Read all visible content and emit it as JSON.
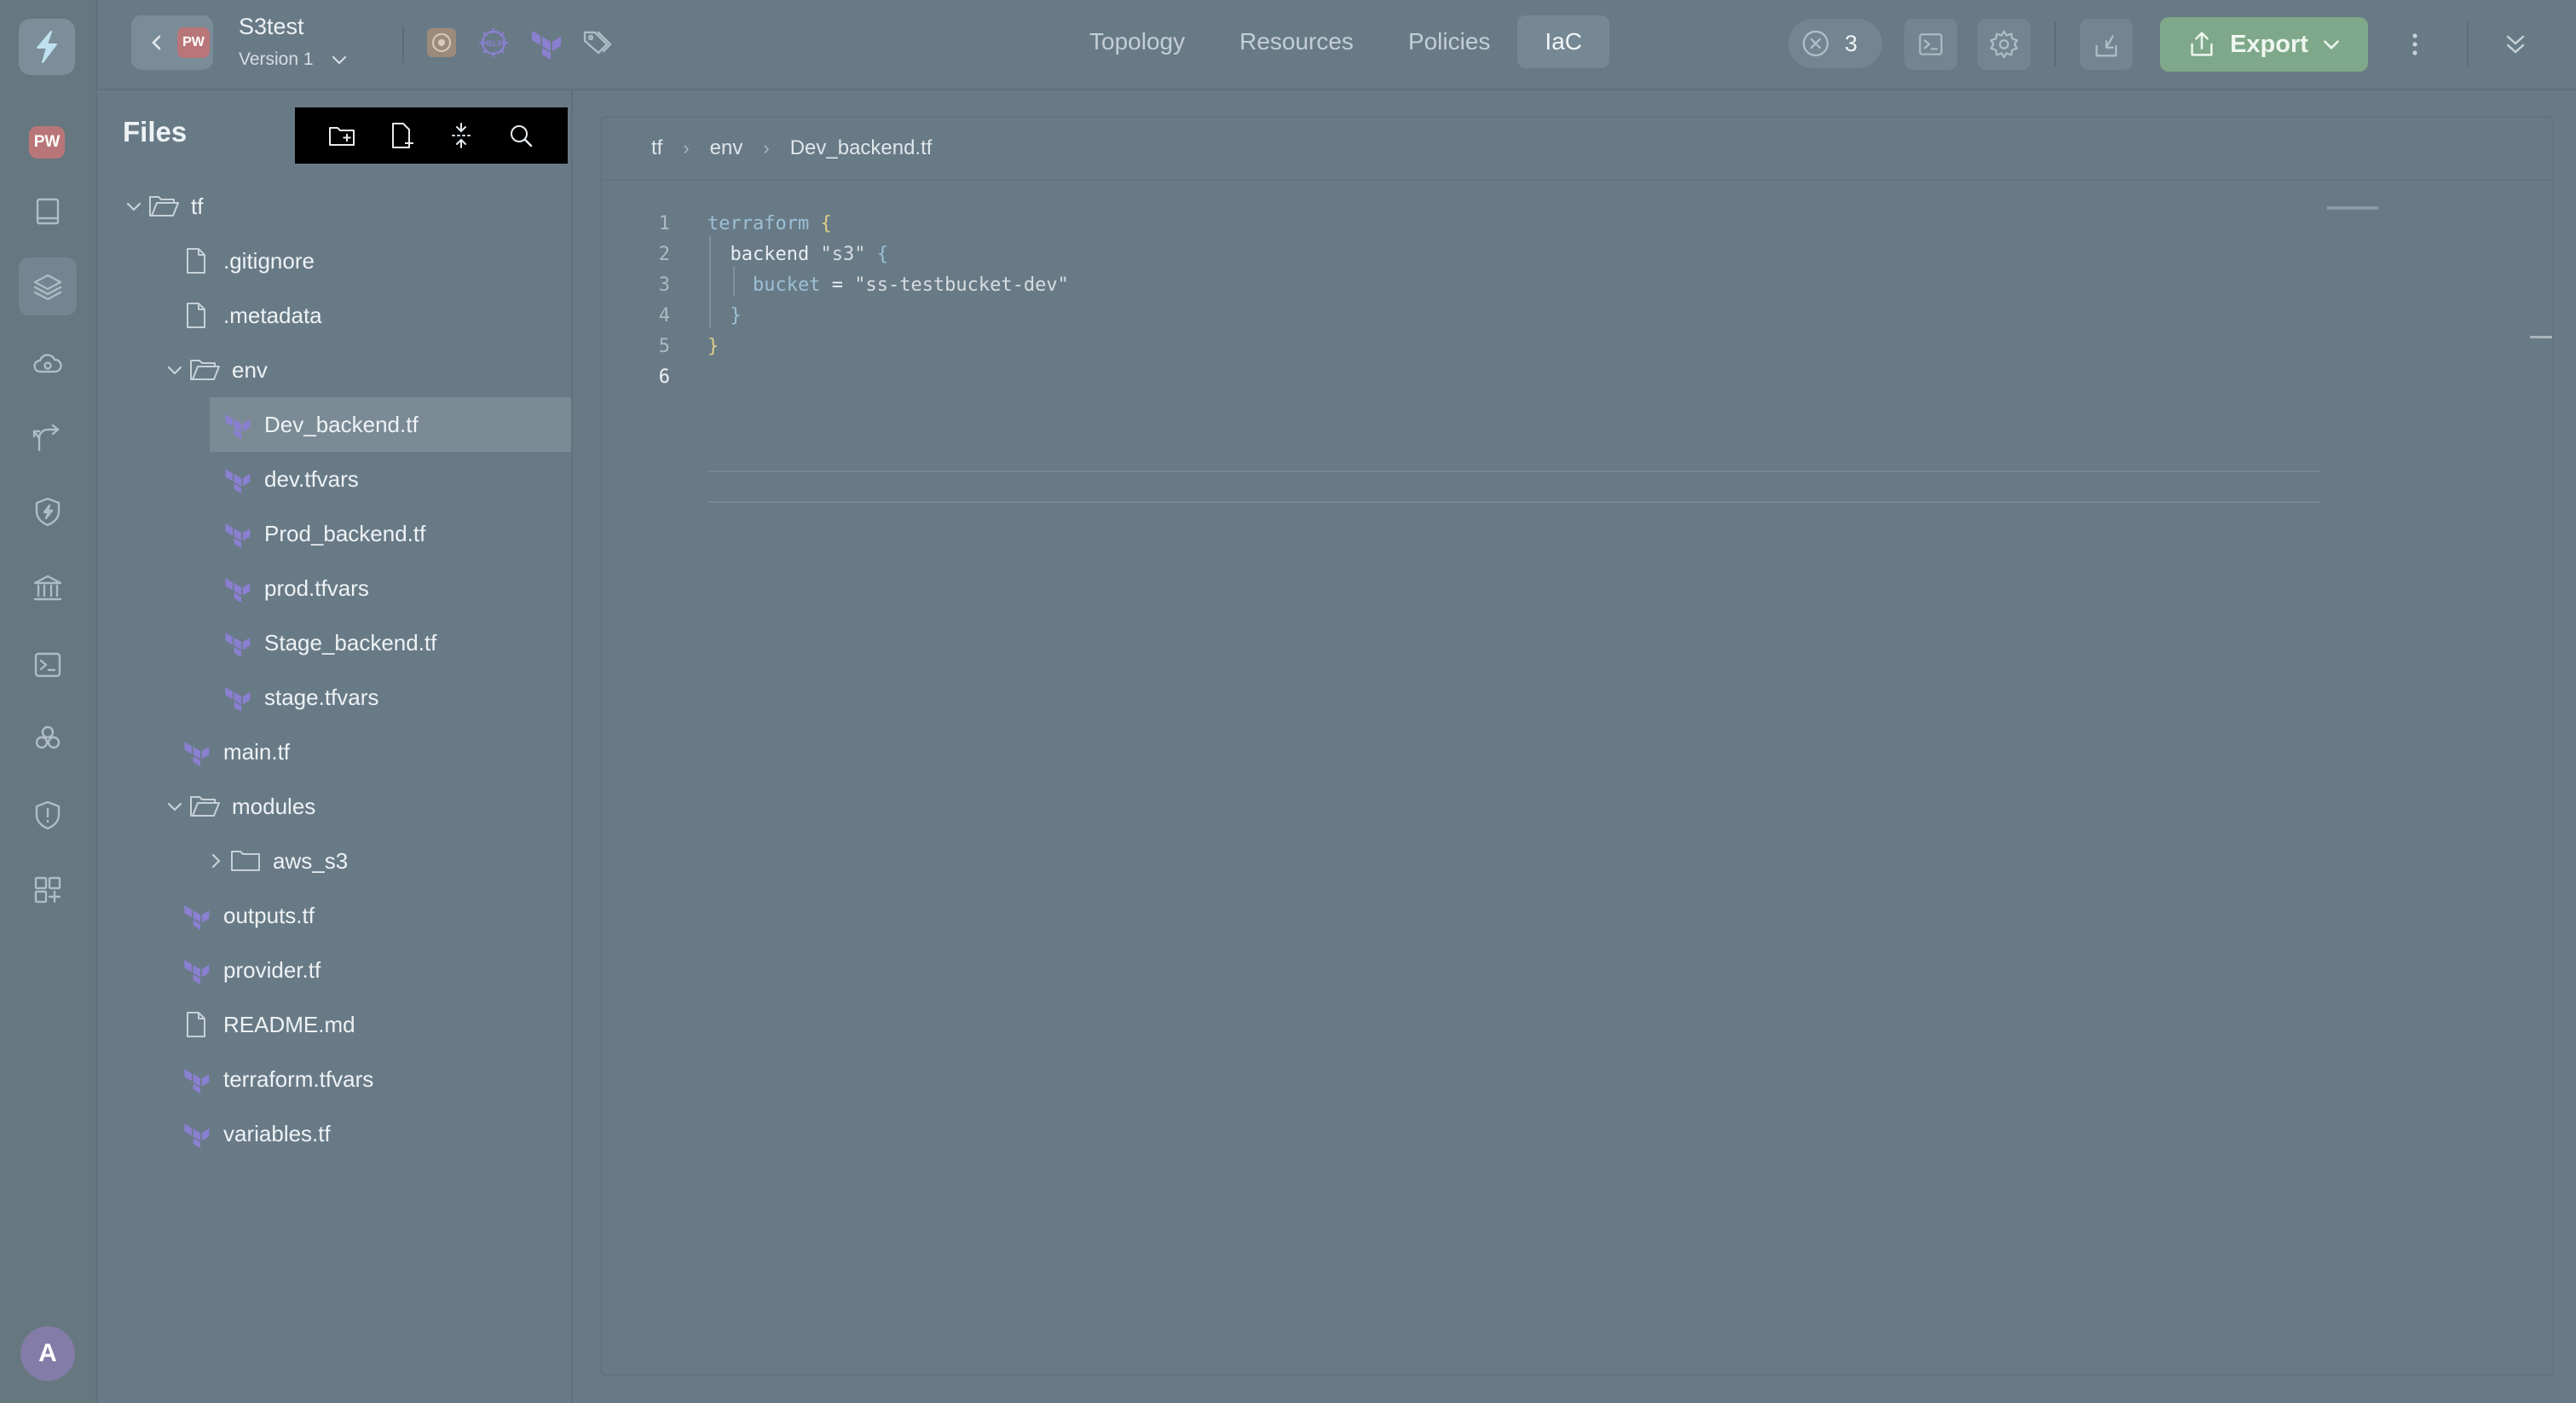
{
  "project": {
    "name": "S3test",
    "version": "Version 1",
    "badge": "PW"
  },
  "rail": {
    "badge": "PW",
    "avatar": "A"
  },
  "tabs": [
    {
      "label": "Topology",
      "active": false
    },
    {
      "label": "Resources",
      "active": false
    },
    {
      "label": "Policies",
      "active": false
    },
    {
      "label": "IaC",
      "active": true
    }
  ],
  "toolbar": {
    "alert_count": "3",
    "export_label": "Export"
  },
  "files": {
    "title": "Files",
    "tree": [
      {
        "label": "tf",
        "type": "folder",
        "expanded": true,
        "depth": 0
      },
      {
        "label": ".gitignore",
        "type": "file",
        "depth": 1
      },
      {
        "label": ".metadata",
        "type": "file",
        "depth": 1
      },
      {
        "label": "env",
        "type": "folder",
        "expanded": true,
        "depth": 1
      },
      {
        "label": "Dev_backend.tf",
        "type": "terraform",
        "depth": 2,
        "selected": true
      },
      {
        "label": "dev.tfvars",
        "type": "terraform",
        "depth": 2
      },
      {
        "label": "Prod_backend.tf",
        "type": "terraform",
        "depth": 2
      },
      {
        "label": "prod.tfvars",
        "type": "terraform",
        "depth": 2
      },
      {
        "label": "Stage_backend.tf",
        "type": "terraform",
        "depth": 2
      },
      {
        "label": "stage.tfvars",
        "type": "terraform",
        "depth": 2
      },
      {
        "label": "main.tf",
        "type": "terraform",
        "depth": 1
      },
      {
        "label": "modules",
        "type": "folder",
        "expanded": true,
        "depth": 1
      },
      {
        "label": "aws_s3",
        "type": "folder",
        "expanded": false,
        "depth": 2
      },
      {
        "label": "outputs.tf",
        "type": "terraform",
        "depth": 1
      },
      {
        "label": "provider.tf",
        "type": "terraform",
        "depth": 1
      },
      {
        "label": "README.md",
        "type": "file",
        "depth": 1
      },
      {
        "label": "terraform.tfvars",
        "type": "terraform",
        "depth": 1
      },
      {
        "label": "variables.tf",
        "type": "terraform",
        "depth": 1
      }
    ]
  },
  "breadcrumb": [
    "tf",
    "env",
    "Dev_backend.tf"
  ],
  "code": {
    "line_numbers": [
      "1",
      "2",
      "3",
      "4",
      "5",
      "6"
    ],
    "l1_kw": "terraform",
    "l1_br": "{",
    "l2_kw": "backend",
    "l2_str": "\"s3\"",
    "l2_br": "{",
    "l3_kw": "bucket",
    "l3_eq": "=",
    "l3_str": "\"ss-testbucket-dev\"",
    "l4_br": "}",
    "l5_br": "}"
  },
  "colors": {
    "terraform_icon": "#8b7fd1",
    "export_button": "#7ea889",
    "pw_badge": "#b97678"
  }
}
